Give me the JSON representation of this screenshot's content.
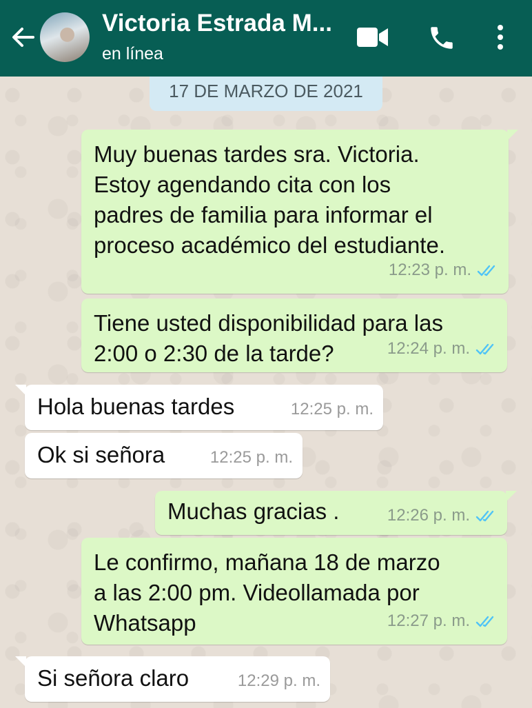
{
  "header": {
    "contact_name": "Victoria Estrada M...",
    "status": "en línea"
  },
  "date_chip": "17 DE MARZO DE 2021",
  "messages": [
    {
      "direction": "out",
      "lines": [
        "Muy buenas tardes sra. Victoria.",
        "Estoy agendando cita con los",
        "padres de familia para informar el",
        "proceso académico del estudiante."
      ],
      "time": "12:23 p. m.",
      "read": true
    },
    {
      "direction": "out",
      "lines": [
        "Tiene usted disponibilidad para las",
        "2:00 o 2:30 de la tarde?"
      ],
      "time": "12:24 p. m.",
      "read": true
    },
    {
      "direction": "in",
      "lines": [
        "Hola buenas tardes"
      ],
      "time": "12:25 p. m."
    },
    {
      "direction": "in",
      "lines": [
        "Ok si señora"
      ],
      "time": "12:25 p. m."
    },
    {
      "direction": "out",
      "lines": [
        "Muchas gracias ."
      ],
      "time": "12:26 p. m.",
      "read": true
    },
    {
      "direction": "out",
      "lines": [
        "Le confirmo, mañana 18 de marzo",
        "a las 2:00 pm. Videollamada por",
        "Whatsapp"
      ],
      "time": "12:27 p. m.",
      "read": true
    },
    {
      "direction": "in",
      "lines": [
        "Si señora claro"
      ],
      "time": "12:29 p. m."
    }
  ],
  "colors": {
    "header": "#075e54",
    "outgoing_bubble": "#dcf8c6",
    "incoming_bubble": "#ffffff",
    "read_ticks": "#4fc3f7",
    "date_chip": "#d4eaf4"
  },
  "icons": [
    "back-arrow-icon",
    "video-call-icon",
    "phone-icon",
    "more-vert-icon",
    "double-check-icon"
  ]
}
